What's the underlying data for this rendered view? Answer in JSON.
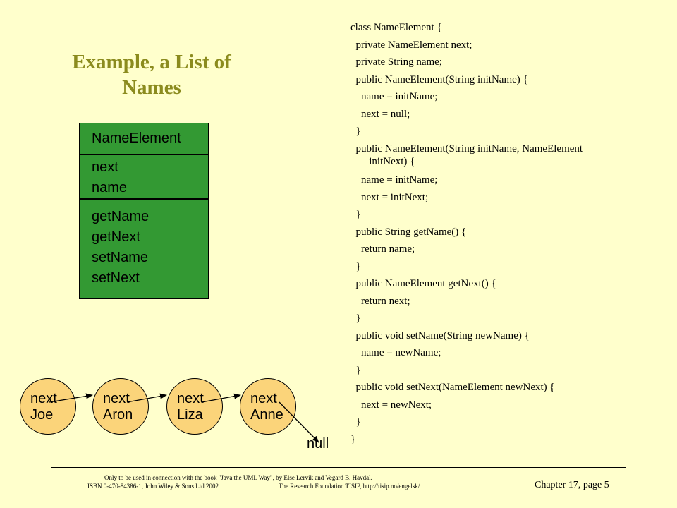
{
  "title": {
    "line1": "Example, a List of",
    "line2": "Names"
  },
  "uml": {
    "class_name": "NameElement",
    "attributes": [
      "next",
      "name"
    ],
    "operations": [
      "getName",
      "getNext",
      "setName",
      "setNext"
    ]
  },
  "code_lines": [
    "class NameElement {",
    "  private NameElement next;",
    "  private String name;",
    "  public NameElement(String initName) {",
    "    name = initName;",
    "    next = null;",
    "  }",
    "  public NameElement(String initName, NameElement",
    "       initNext) {",
    "    name = initName;",
    "    next = initNext;",
    "  }",
    "  public String getName() {",
    "    return name;",
    "  }",
    "  public NameElement getNext() {",
    "    return next;",
    "  }",
    "  public void setName(String newName) {",
    "    name = newName;",
    "  }",
    "  public void setNext(NameElement newNext) {",
    "    next = newNext;",
    "  }",
    "}"
  ],
  "nodes": [
    {
      "field": "next",
      "name": "Joe"
    },
    {
      "field": "next",
      "name": "Aron"
    },
    {
      "field": "next",
      "name": "Liza"
    },
    {
      "field": "next",
      "name": "Anne"
    }
  ],
  "null_label": "null",
  "footer": {
    "line1": "Only to be used in connection with the book \"Java the UML Way\", by Else Lervik and Vegard B. Havdal.",
    "line2a": "ISBN 0-470-84386-1, John Wiley & Sons Ltd 2002",
    "line2b": "The Research Foundation TISIP, http://tisip.no/engelsk/",
    "chapter": "Chapter 17, page 5"
  }
}
